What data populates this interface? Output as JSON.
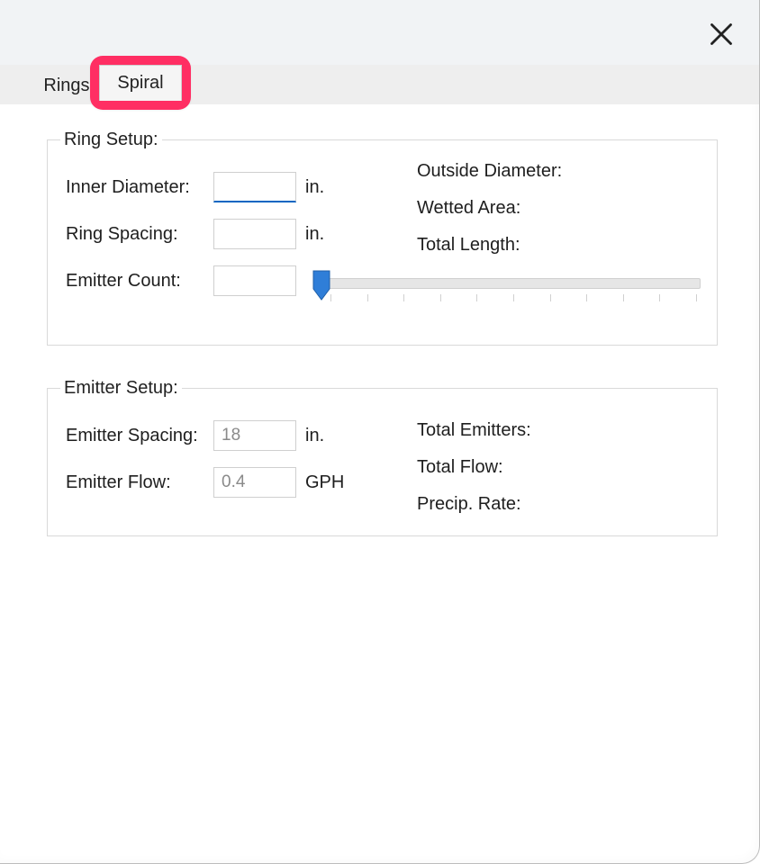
{
  "tabs": {
    "rings": "Rings",
    "spiral": "Spiral"
  },
  "ring_setup": {
    "legend": "Ring Setup:",
    "inner_diameter_label": "Inner Diameter:",
    "inner_diameter_value": "",
    "inner_diameter_unit": "in.",
    "ring_spacing_label": "Ring Spacing:",
    "ring_spacing_value": "",
    "ring_spacing_unit": "in.",
    "emitter_count_label": "Emitter Count:",
    "emitter_count_value": "",
    "outside_diameter_label": "Outside Diameter:",
    "wetted_area_label": "Wetted Area:",
    "total_length_label": "Total Length:"
  },
  "emitter_setup": {
    "legend": "Emitter Setup:",
    "spacing_label": "Emitter Spacing:",
    "spacing_value": "18",
    "spacing_unit": "in.",
    "flow_label": "Emitter Flow:",
    "flow_value": "0.4",
    "flow_unit": "GPH",
    "total_emitters_label": "Total Emitters:",
    "total_flow_label": "Total Flow:",
    "precip_rate_label": "Precip. Rate:"
  }
}
